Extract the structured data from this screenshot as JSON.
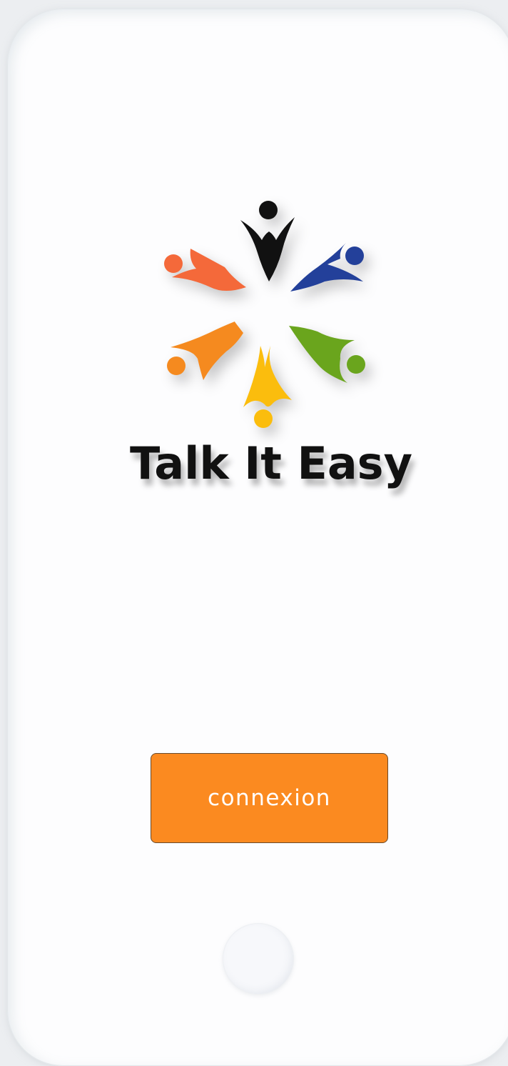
{
  "app": {
    "title": "Talk It Easy"
  },
  "actions": {
    "connect_label": "connexion"
  },
  "icons": {
    "logo": "people-circle-logo-icon",
    "home": "home-button"
  },
  "colors": {
    "button": "#fb8a20",
    "figure_black": "#111111",
    "figure_blue": "#23409a",
    "figure_green": "#6aa51d",
    "figure_yellow": "#fbbd0d",
    "figure_orange_left": "#f57a2a",
    "figure_orange_top_left": "#f4693a"
  }
}
